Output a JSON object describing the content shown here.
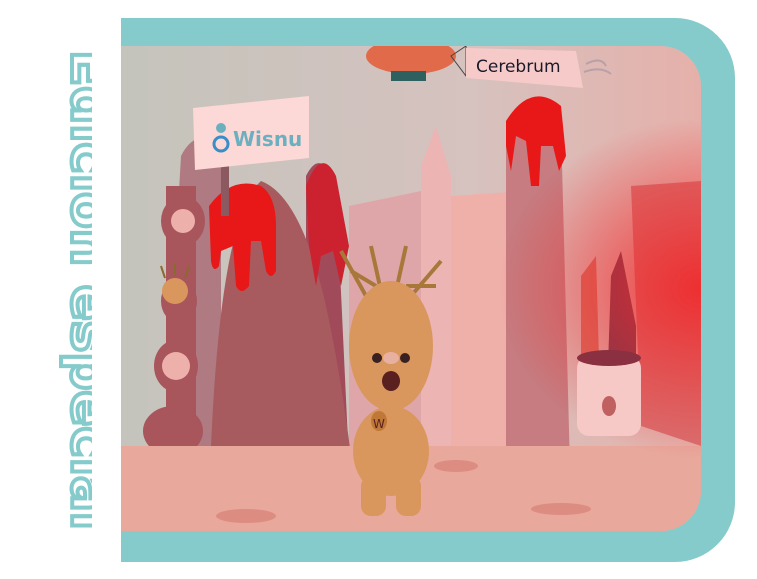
{
  "title": "Edición especial",
  "signs": {
    "left": "Wisnu",
    "banner": "Cerebrum"
  },
  "colors": {
    "frame": "#86cbcb",
    "title": "#86cbcb",
    "sky": "#d2c2bc",
    "ground": "#e8a89c",
    "slime": "#e81818",
    "character": "#d9975e"
  }
}
